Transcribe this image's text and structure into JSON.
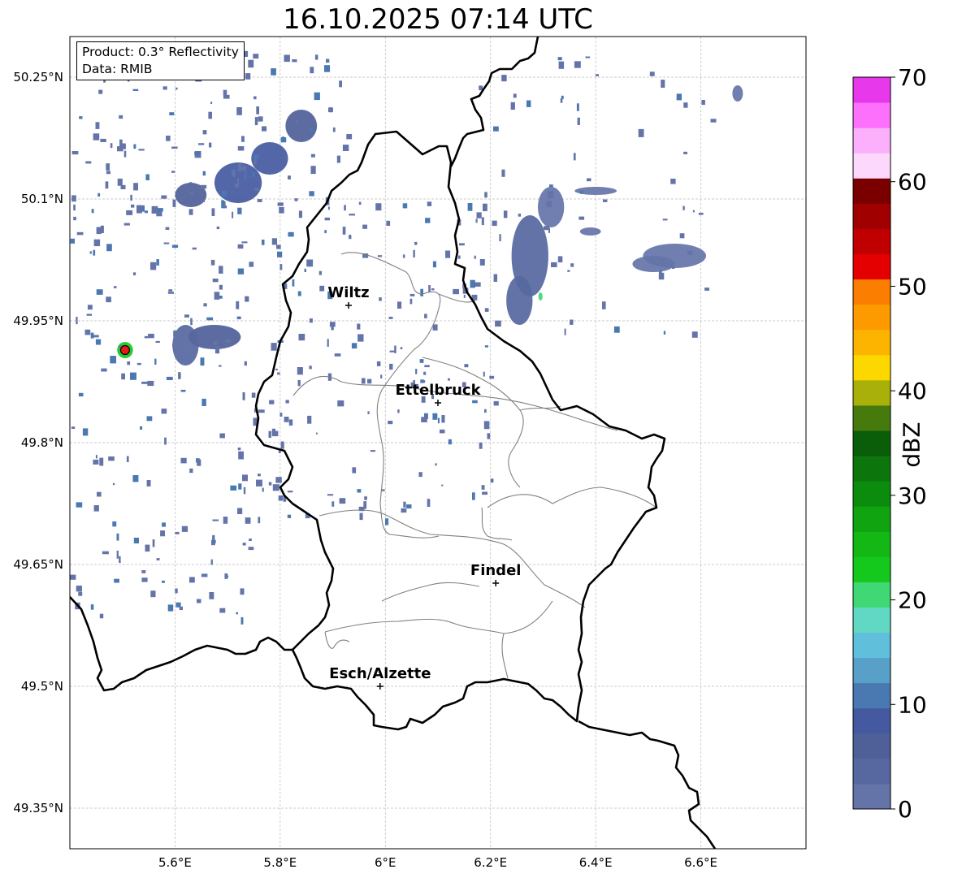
{
  "title": "16.10.2025 07:14 UTC",
  "info": {
    "product": "Product: 0.3° Reflectivity",
    "source": "Data: RMIB"
  },
  "map": {
    "lon_range": [
      5.4,
      6.8
    ],
    "lat_range": [
      49.3,
      50.3
    ],
    "lon_ticks": [
      {
        "value": 5.6,
        "label": "5.6°E"
      },
      {
        "value": 5.8,
        "label": "5.8°E"
      },
      {
        "value": 6.0,
        "label": "6°E"
      },
      {
        "value": 6.2,
        "label": "6.2°E"
      },
      {
        "value": 6.4,
        "label": "6.4°E"
      },
      {
        "value": 6.6,
        "label": "6.6°E"
      }
    ],
    "lat_ticks": [
      {
        "value": 49.35,
        "label": "49.35°N"
      },
      {
        "value": 49.5,
        "label": "49.5°N"
      },
      {
        "value": 49.65,
        "label": "49.65°N"
      },
      {
        "value": 49.8,
        "label": "49.8°N"
      },
      {
        "value": 49.95,
        "label": "49.95°N"
      },
      {
        "value": 50.1,
        "label": "50.1°N"
      },
      {
        "value": 50.25,
        "label": "50.25°N"
      }
    ],
    "gridlines": true,
    "cities": [
      {
        "name": "Wiltz",
        "lon": 5.93,
        "lat": 49.969
      },
      {
        "name": "Ettelbruck",
        "lon": 6.1,
        "lat": 49.849
      },
      {
        "name": "Findel",
        "lon": 6.21,
        "lat": 49.627
      },
      {
        "name": "Esch/Alzette",
        "lon": 5.99,
        "lat": 49.5
      }
    ],
    "radar_site": {
      "lon": 5.505,
      "lat": 49.914,
      "color": "#e31a1c"
    },
    "border_color": "#000000",
    "canton_color": "#808080"
  },
  "colorbar": {
    "label": "dBZ",
    "min": 0,
    "max": 70,
    "ticks": [
      {
        "value": 0,
        "label": "0"
      },
      {
        "value": 10,
        "label": "10"
      },
      {
        "value": 20,
        "label": "20"
      },
      {
        "value": 30,
        "label": "30"
      },
      {
        "value": 40,
        "label": "40"
      },
      {
        "value": 50,
        "label": "50"
      },
      {
        "value": 60,
        "label": "60"
      },
      {
        "value": 70,
        "label": "70"
      }
    ],
    "colors": [
      "#6474a8",
      "#5767a0",
      "#4f5f98",
      "#44599f",
      "#4a78b0",
      "#58a0c8",
      "#60c0dc",
      "#60d8c4",
      "#40d874",
      "#14c81c",
      "#14b814",
      "#10a410",
      "#0c8c0c",
      "#0c760c",
      "#0a5e0a",
      "#467a0c",
      "#aab00a",
      "#fcd800",
      "#fcb400",
      "#fc9a00",
      "#fc7e00",
      "#e40000",
      "#c00000",
      "#a00000",
      "#7a0000",
      "#fcd8fc",
      "#fcb0fc",
      "#fc70fc",
      "#e838ec"
    ]
  },
  "radar_echoes": [
    {
      "lon": 5.72,
      "lat": 50.12,
      "w": 0.09,
      "h": 0.05,
      "dbz": 8
    },
    {
      "lon": 5.78,
      "lat": 50.15,
      "w": 0.07,
      "h": 0.04,
      "dbz": 9
    },
    {
      "lon": 5.84,
      "lat": 50.19,
      "w": 0.06,
      "h": 0.04,
      "dbz": 6
    },
    {
      "lon": 5.63,
      "lat": 50.105,
      "w": 0.06,
      "h": 0.03,
      "dbz": 5
    },
    {
      "lon": 5.675,
      "lat": 49.93,
      "w": 0.1,
      "h": 0.03,
      "dbz": 7
    },
    {
      "lon": 5.62,
      "lat": 49.92,
      "w": 0.05,
      "h": 0.05,
      "dbz": 4
    },
    {
      "lon": 6.275,
      "lat": 50.03,
      "w": 0.07,
      "h": 0.1,
      "dbz": 3
    },
    {
      "lon": 6.255,
      "lat": 49.975,
      "w": 0.05,
      "h": 0.06,
      "dbz": 4
    },
    {
      "lon": 6.315,
      "lat": 50.09,
      "w": 0.05,
      "h": 0.05,
      "dbz": 2
    },
    {
      "lon": 6.55,
      "lat": 50.03,
      "w": 0.12,
      "h": 0.03,
      "dbz": 1
    },
    {
      "lon": 6.51,
      "lat": 50.02,
      "w": 0.08,
      "h": 0.02,
      "dbz": 1
    },
    {
      "lon": 5.505,
      "lat": 49.914,
      "w": 0.03,
      "h": 0.02,
      "dbz": 22
    },
    {
      "lon": 6.295,
      "lat": 49.98,
      "w": 0.008,
      "h": 0.01,
      "dbz": 20
    },
    {
      "lon": 6.4,
      "lat": 50.11,
      "w": 0.08,
      "h": 0.01,
      "dbz": 2
    },
    {
      "lon": 6.39,
      "lat": 50.06,
      "w": 0.04,
      "h": 0.01,
      "dbz": 2
    },
    {
      "lon": 6.67,
      "lat": 50.23,
      "w": 0.02,
      "h": 0.02,
      "dbz": 2
    }
  ]
}
